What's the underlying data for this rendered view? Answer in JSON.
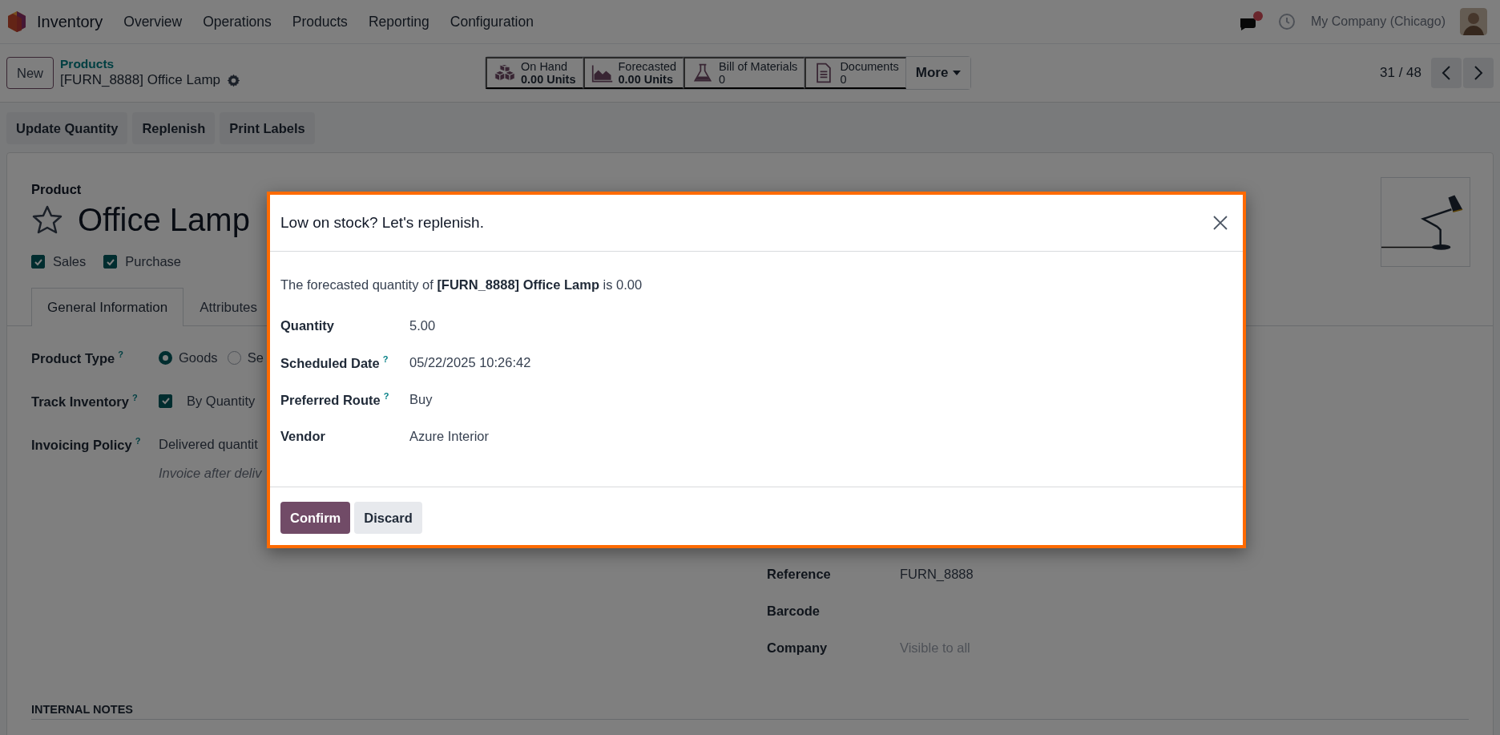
{
  "navbar": {
    "app": "Inventory",
    "menu": [
      "Overview",
      "Operations",
      "Products",
      "Reporting",
      "Configuration"
    ],
    "company": "My Company (Chicago)"
  },
  "control_panel": {
    "new_button": "New",
    "breadcrumb": "Products",
    "record": "[FURN_8888] Office Lamp",
    "stats": [
      {
        "kind": "boxes",
        "label": "On Hand",
        "value": "0.00 Units"
      },
      {
        "kind": "chart",
        "label": "Forecasted",
        "value": "0.00 Units"
      },
      {
        "kind": "flask",
        "label": "Bill of Materials",
        "value": "0"
      },
      {
        "kind": "document",
        "label": "Documents",
        "value": "0"
      }
    ],
    "more": "More",
    "pager": "31 / 48"
  },
  "actions": [
    "Update Quantity",
    "Replenish",
    "Print Labels"
  ],
  "form": {
    "label": "Product",
    "name": "Office Lamp",
    "starred": false,
    "options": [
      {
        "label": "Sales",
        "checked": true
      },
      {
        "label": "Purchase",
        "checked": true
      }
    ],
    "tabs": [
      {
        "label": "General Information",
        "selected": true
      },
      {
        "label": "Attributes",
        "selected": false
      }
    ],
    "fields": [
      {
        "kind": "radio",
        "label": "Product Type",
        "help": "?",
        "options": [
          {
            "label": "Goods",
            "selected": true
          },
          {
            "label": "Se",
            "selected": false
          }
        ]
      },
      {
        "kind": "checkbox",
        "label": "Track Inventory",
        "help": "?",
        "checked": true,
        "value": "By Quantity"
      },
      {
        "kind": "text",
        "label": "Invoicing Policy",
        "help": "?",
        "value": "Delivered quantit",
        "note": "Invoice after deliv"
      }
    ],
    "right_fields": [
      {
        "label": "Reference",
        "value": "FURN_8888"
      },
      {
        "label": "Barcode"
      },
      {
        "label": "Company",
        "placeholder": "Visible to all"
      }
    ],
    "notes_title": "INTERNAL NOTES"
  },
  "dialog": {
    "title": "Low on stock? Let's replenish.",
    "message": "The forecasted quantity of **[FURN_8888] Office Lamp** is 0.00",
    "fields": [
      {
        "label": "Quantity",
        "value": "5.00"
      },
      {
        "label": "Scheduled Date",
        "help": "?",
        "value": "05/22/2025 10:26:42"
      },
      {
        "label": "Preferred Route",
        "help": "?",
        "value": "Buy"
      },
      {
        "label": "Vendor",
        "value": "Azure Interior"
      }
    ],
    "buttons": [
      {
        "kind": "primary",
        "label": "Confirm"
      },
      {
        "kind": "secondary",
        "label": "Discard"
      }
    ]
  }
}
